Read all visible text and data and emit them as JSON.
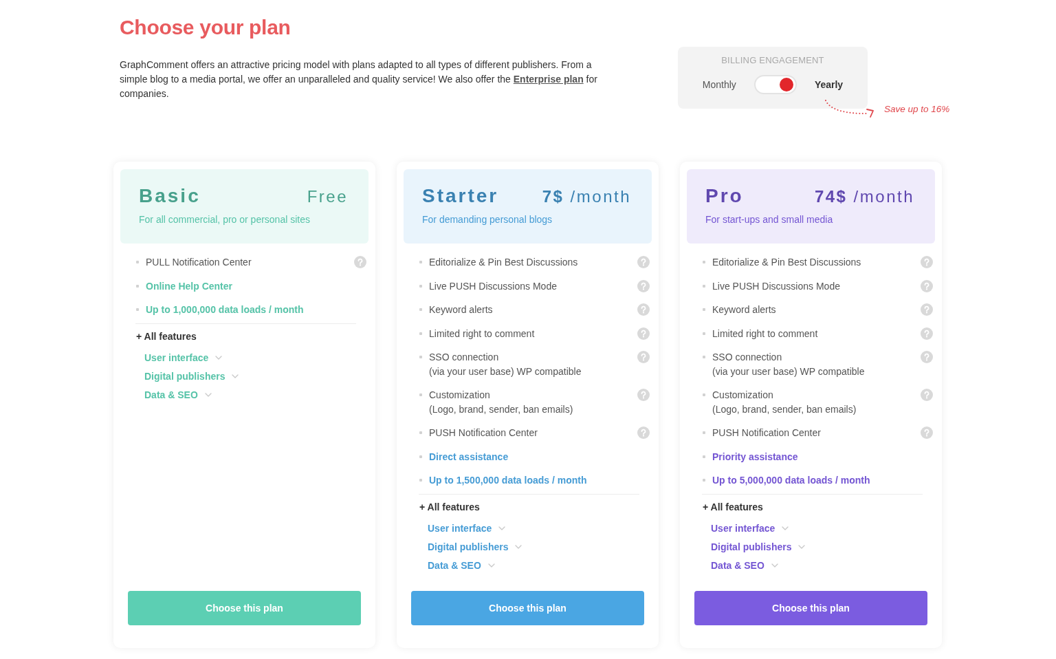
{
  "title": "Choose your plan",
  "intro": {
    "text_before": "GraphComment offers an attractive pricing model with plans adapted to all types of different publishers. From a simple blog to a media portal, we offer an unparalleled and quality service! We also offer the ",
    "link": "Enterprise plan",
    "text_after": " for companies."
  },
  "billing": {
    "title": "BILLING ENGAGEMENT",
    "options": [
      {
        "label": "Monthly",
        "selected": false
      },
      {
        "label": "Yearly",
        "selected": true
      }
    ],
    "note": "Save up to 16%"
  },
  "plans": [
    {
      "name": "Basic",
      "price": "Free",
      "subtitle": "For all commercial, pro or personal sites",
      "color": "#5ccfb3",
      "features": [
        {
          "kind": "feature",
          "text": "PULL Notification Center"
        },
        {
          "kind": "highlight",
          "text": "Online Help Center"
        },
        {
          "kind": "highlight",
          "text": "Up to 1,000,000 data loads / month"
        }
      ],
      "all_features": {
        "label": "+ All features",
        "groups": [
          {
            "label": "User interface",
            "expanded": false
          },
          {
            "label": "Digital publishers",
            "expanded": false
          },
          {
            "label": "Data & SEO",
            "expanded": false
          }
        ]
      },
      "button": "Choose this plan"
    },
    {
      "name": "Starter",
      "price": "**7$** /month",
      "subtitle": "For demanding personal blogs",
      "color": "#4aa6e3",
      "features": [
        {
          "kind": "feature",
          "text": "Editorialize & Pin Best Discussions"
        },
        {
          "kind": "feature",
          "text": "Live PUSH Discussions Mode"
        },
        {
          "kind": "feature",
          "text": "Keyword alerts"
        },
        {
          "kind": "feature",
          "text": "Limited right to comment"
        },
        {
          "kind": "feature",
          "text": "SSO connection",
          "detail": "(via your user base) WP compatible"
        },
        {
          "kind": "feature",
          "text": "Customization",
          "detail": "(Logo, brand, sender, ban emails)"
        },
        {
          "kind": "feature",
          "text": "PUSH Notification Center"
        },
        {
          "kind": "highlight",
          "text": "Direct assistance"
        },
        {
          "kind": "highlight",
          "text": "Up to 1,500,000 data loads / month"
        }
      ],
      "all_features": {
        "label": "+ All features",
        "groups": [
          {
            "label": "User interface",
            "expanded": false
          },
          {
            "label": "Digital publishers",
            "expanded": false
          },
          {
            "label": "Data & SEO",
            "expanded": false
          }
        ]
      },
      "button": "Choose this plan"
    },
    {
      "name": "Pro",
      "price": "**74$** /month",
      "subtitle": "For start-ups and small media",
      "color": "#7b5ce0",
      "features": [
        {
          "kind": "feature",
          "text": "Editorialize & Pin Best Discussions"
        },
        {
          "kind": "feature",
          "text": "Live PUSH Discussions Mode"
        },
        {
          "kind": "feature",
          "text": "Keyword alerts"
        },
        {
          "kind": "feature",
          "text": "Limited right to comment"
        },
        {
          "kind": "feature",
          "text": "SSO connection",
          "detail": "(via your user base) WP compatible"
        },
        {
          "kind": "feature",
          "text": "Customization",
          "detail": "(Logo, brand, sender, ban emails)"
        },
        {
          "kind": "feature",
          "text": "PUSH Notification Center"
        },
        {
          "kind": "highlight",
          "text": "Priority assistance"
        },
        {
          "kind": "highlight",
          "text": "Up to 5,000,000 data loads / month"
        }
      ],
      "all_features": {
        "label": "+ All features",
        "groups": [
          {
            "label": "User interface",
            "expanded": false
          },
          {
            "label": "Digital publishers",
            "expanded": false
          },
          {
            "label": "Data & SEO",
            "expanded": false
          }
        ]
      },
      "button": "Choose this plan"
    }
  ]
}
